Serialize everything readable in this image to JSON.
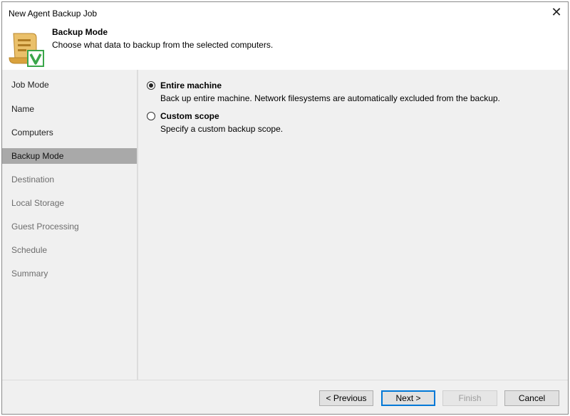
{
  "window": {
    "title": "New Agent Backup Job",
    "close_symbol": "✕"
  },
  "header": {
    "title": "Backup Mode",
    "description": "Choose what data to backup from the selected computers."
  },
  "steps": [
    {
      "label": "Job Mode",
      "state": "done"
    },
    {
      "label": "Name",
      "state": "done"
    },
    {
      "label": "Computers",
      "state": "done"
    },
    {
      "label": "Backup Mode",
      "state": "active"
    },
    {
      "label": "Destination",
      "state": "pending"
    },
    {
      "label": "Local Storage",
      "state": "pending"
    },
    {
      "label": "Guest Processing",
      "state": "pending"
    },
    {
      "label": "Schedule",
      "state": "pending"
    },
    {
      "label": "Summary",
      "state": "pending"
    }
  ],
  "options": [
    {
      "label": "Entire machine",
      "description": "Back up entire machine. Network filesystems are automatically excluded from the backup.",
      "selected": true
    },
    {
      "label": "Custom scope",
      "description": "Specify a custom backup scope.",
      "selected": false
    }
  ],
  "buttons": {
    "previous": "< Previous",
    "next": "Next >",
    "finish": "Finish",
    "cancel": "Cancel"
  },
  "icons": {
    "header": "backup-scroll-icon",
    "close": "close-icon"
  },
  "colors": {
    "accent": "#0078d7",
    "active_step": "#a9a9a9",
    "panel": "#f0f0f0",
    "icon_gold": "#e7b550",
    "icon_green": "#3aa64a"
  }
}
